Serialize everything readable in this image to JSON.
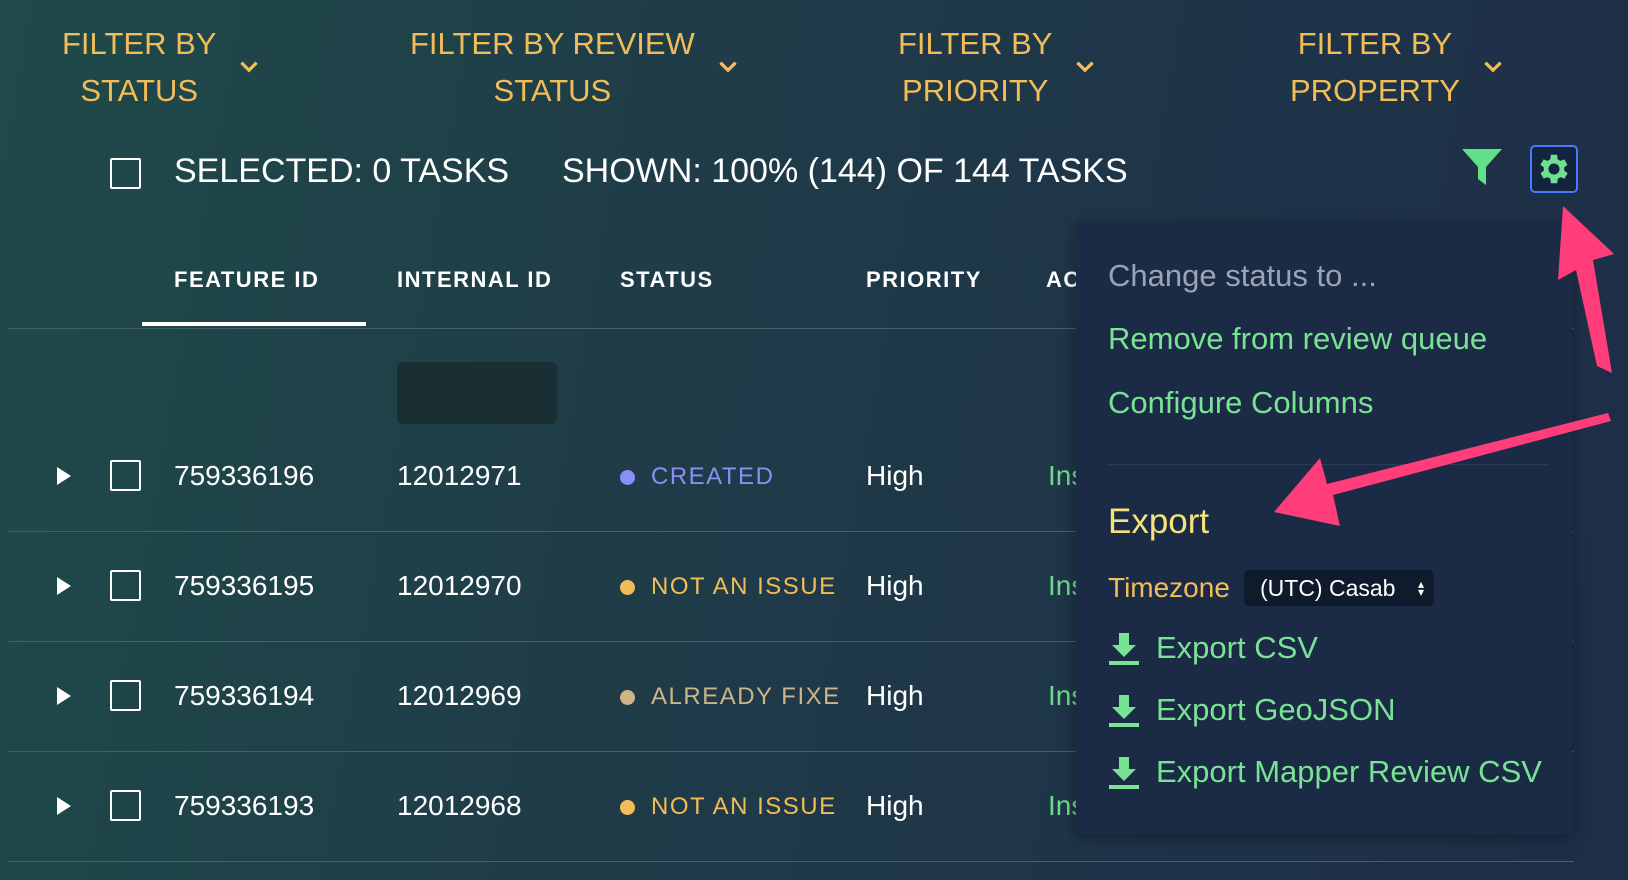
{
  "filters": [
    {
      "line1": "FILTER BY",
      "line2": "STATUS"
    },
    {
      "line1": "FILTER BY REVIEW",
      "line2": "STATUS"
    },
    {
      "line1": "FILTER BY",
      "line2": "PRIORITY"
    },
    {
      "line1": "FILTER BY",
      "line2": "PROPERTY"
    }
  ],
  "selection": {
    "selected_text": "SELECTED: 0 TASKS",
    "shown_text": "SHOWN: 100% (144) OF 144 TASKS"
  },
  "columns": {
    "feature_id": "FEATURE ID",
    "internal_id": "INTERNAL ID",
    "status": "STATUS",
    "priority": "PRIORITY",
    "actions": "AC"
  },
  "rows": [
    {
      "feature_id": "759336196",
      "internal_id": "12012971",
      "status": "CREATED",
      "status_color": "#8a8ff5",
      "priority": "High",
      "action": "Ins"
    },
    {
      "feature_id": "759336195",
      "internal_id": "12012970",
      "status": "NOT AN ISSUE",
      "status_color": "#f2bd59",
      "priority": "High",
      "action": "Ins"
    },
    {
      "feature_id": "759336194",
      "internal_id": "12012969",
      "status": "ALREADY FIXED",
      "status_color": "#cdb58a",
      "priority": "High",
      "action": "Ins"
    },
    {
      "feature_id": "759336193",
      "internal_id": "12012968",
      "status": "NOT AN ISSUE",
      "status_color": "#f2bd59",
      "priority": "High",
      "action": "Ins"
    }
  ],
  "menu": {
    "change_status": "Change status to ...",
    "remove_review": "Remove from review queue",
    "configure_columns": "Configure Columns",
    "export_title": "Export",
    "timezone_label": "Timezone",
    "timezone_value": "(UTC) Casab",
    "export_csv": "Export CSV",
    "export_geojson": "Export GeoJSON",
    "export_mapper_review": "Export Mapper Review CSV"
  },
  "colors": {
    "accent_orange": "#f2bd59",
    "accent_green": "#79e394",
    "export_yellow": "#f5e27a",
    "annotation_arrow": "#ff3d7a",
    "gear_border": "#4a78ff"
  },
  "icons": [
    "chevron-down-icon",
    "filter-icon",
    "gear-icon",
    "expand-arrow-icon",
    "download-icon"
  ]
}
